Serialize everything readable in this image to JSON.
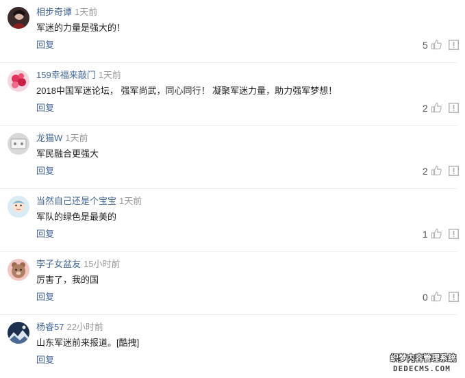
{
  "comments": [
    {
      "username": "相步奇谭",
      "time": "1天前",
      "text": "军迷的力量是强大的！",
      "reply": "回复",
      "likes": "5",
      "avatar": "avatar-dark-portrait"
    },
    {
      "username": "159幸福来敲门",
      "time": "1天前",
      "text": "2018中国军迷论坛， 强军尚武，同心同行！ 凝聚军迷力量，助力强军梦想！",
      "reply": "回复",
      "likes": "2",
      "avatar": "avatar-pink-flowers"
    },
    {
      "username": "龙猫W",
      "time": "1天前",
      "text": "军民融合更强大",
      "reply": "回复",
      "likes": "2",
      "avatar": "avatar-gray-device"
    },
    {
      "username": "当然自己还是个宝宝",
      "time": "1天前",
      "text": "军队的绿色是最美的",
      "reply": "回复",
      "likes": "1",
      "avatar": "avatar-cartoon-baby"
    },
    {
      "username": "孛子女盆友",
      "time": "15小时前",
      "text": "厉害了，我的国",
      "reply": "回复",
      "likes": "0",
      "avatar": "avatar-cartoon-bear"
    },
    {
      "username": "杨睿57",
      "time": "22小时前",
      "text": "山东军迷前来报道。[酷拽]",
      "reply": "回复",
      "likes": "",
      "avatar": "avatar-mountain-night"
    }
  ],
  "icons": {
    "like": "thumbs-up-icon",
    "report": "report-icon"
  },
  "colors": {
    "username": "#406599",
    "time": "#999999",
    "text": "#222222",
    "reply": "#406599",
    "icon": "#b3b3b3"
  },
  "watermark": {
    "line1": "织梦内容管理系统",
    "line2": "DEDECMS.COM"
  }
}
